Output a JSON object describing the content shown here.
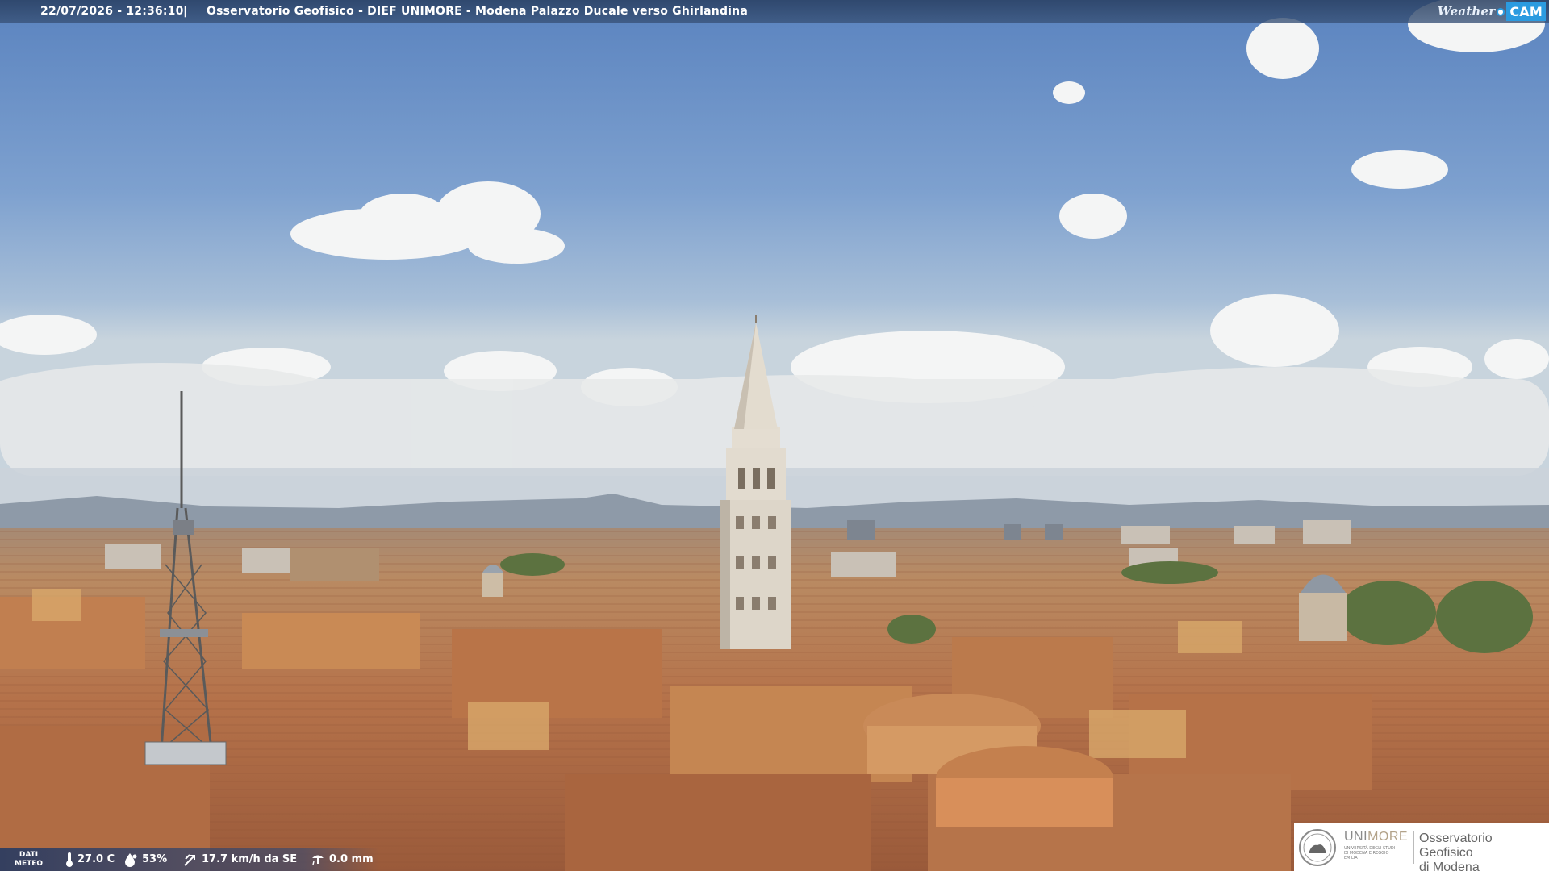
{
  "header": {
    "timestamp": "22/07/2026 - 12:36:10",
    "separator": "|",
    "title": "Osservatorio Geofisico - DIEF UNIMORE - Modena Palazzo Ducale verso Ghirlandina"
  },
  "brand": {
    "weather_text": "Weather",
    "cam_text": "CAM",
    "accent_color": "#2b9be0"
  },
  "meteo": {
    "label_line1": "DATI",
    "label_line2": "METEO",
    "temperature": "27.0 C",
    "humidity": "53%",
    "wind": "17.7 km/h da SE",
    "rain": "0.0 mm",
    "icons": [
      "thermometer-icon",
      "humidity-drop-icon",
      "wind-icon",
      "rain-icon"
    ]
  },
  "logo": {
    "uni_part1": "UNI",
    "uni_part2": "MORE",
    "uni_sub": "UNIVERSITÀ DEGLI STUDI DI MODENA E REGGIO EMILIA",
    "observatory_line1": "Osservatorio Geofisico",
    "observatory_line2": "di Modena"
  },
  "colors": {
    "sky_top": "#5e86c0",
    "sky_horizon": "#c6d3dd",
    "roofs": "#b9784a",
    "tower": "#e3dcd0"
  }
}
